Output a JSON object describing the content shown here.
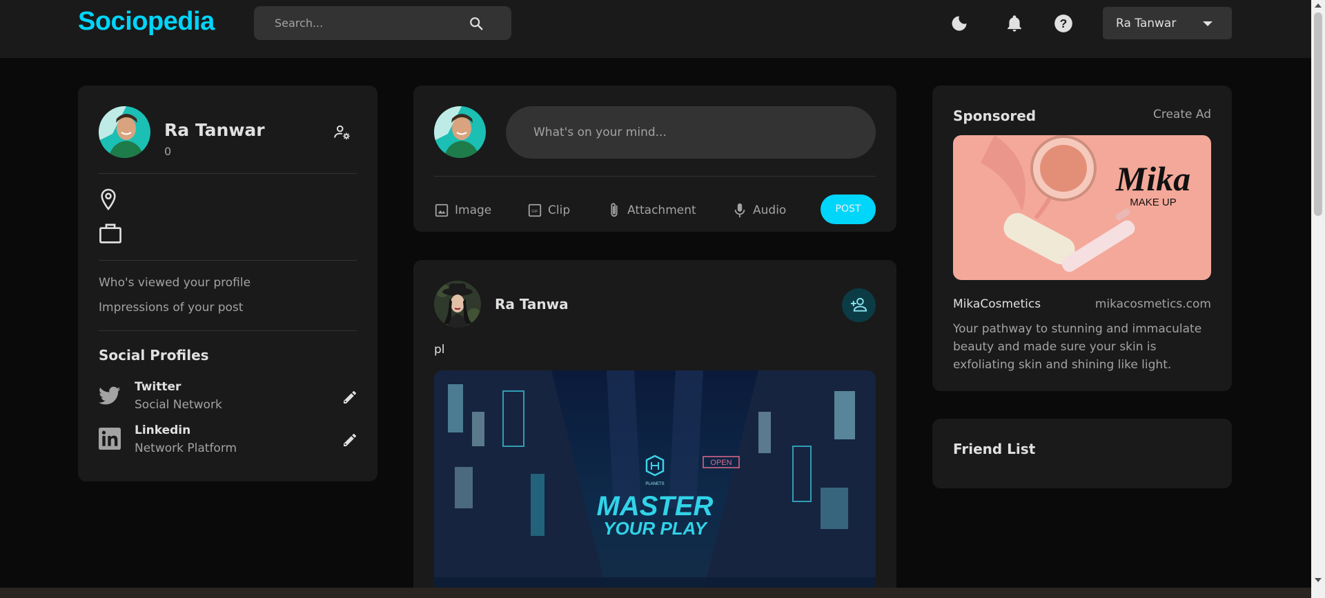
{
  "nav": {
    "brand": "Sociopedia",
    "search_placeholder": "Search...",
    "icons": [
      "dark-mode-icon",
      "notifications-icon",
      "help-icon"
    ],
    "user_select": "Ra Tanwar"
  },
  "profile": {
    "name": "Ra Tanwar",
    "friends_count": "0",
    "location": "",
    "occupation": "",
    "stats": [
      {
        "label": "Who's viewed your profile",
        "value": ""
      },
      {
        "label": "Impressions of your post",
        "value": ""
      }
    ],
    "social_title": "Social Profiles",
    "socials": [
      {
        "name": "Twitter",
        "sub": "Social Network",
        "icon": "twitter-icon"
      },
      {
        "name": "Linkedin",
        "sub": "Network Platform",
        "icon": "linkedin-icon"
      }
    ]
  },
  "composer": {
    "placeholder": "What's on your mind...",
    "actions": [
      {
        "label": "Image",
        "icon": "image-icon"
      },
      {
        "label": "Clip",
        "icon": "gif-icon"
      },
      {
        "label": "Attachment",
        "icon": "attachment-icon"
      },
      {
        "label": "Audio",
        "icon": "microphone-icon"
      }
    ],
    "post_label": "POST"
  },
  "feed": [
    {
      "author": "Ra Tanwa",
      "text": "pl",
      "image_text": {
        "title_line1": "MASTER",
        "title_line2": "YOUR PLAY",
        "brand": "PLANETS",
        "sign": "OPEN"
      }
    }
  ],
  "ad": {
    "title": "Sponsored",
    "create_label": "Create Ad",
    "image_brand": "Mika",
    "image_sub": "MAKE UP",
    "brand": "MikaCosmetics",
    "site": "mikacosmetics.com",
    "description": "Your pathway to stunning and immaculate beauty and made sure your skin is exfoliating skin and shining like light."
  },
  "friends": {
    "title": "Friend List"
  },
  "colors": {
    "accent": "#00d5fa",
    "background": "#0a0a0a",
    "card": "#1a1a1a",
    "input": "#333333"
  }
}
